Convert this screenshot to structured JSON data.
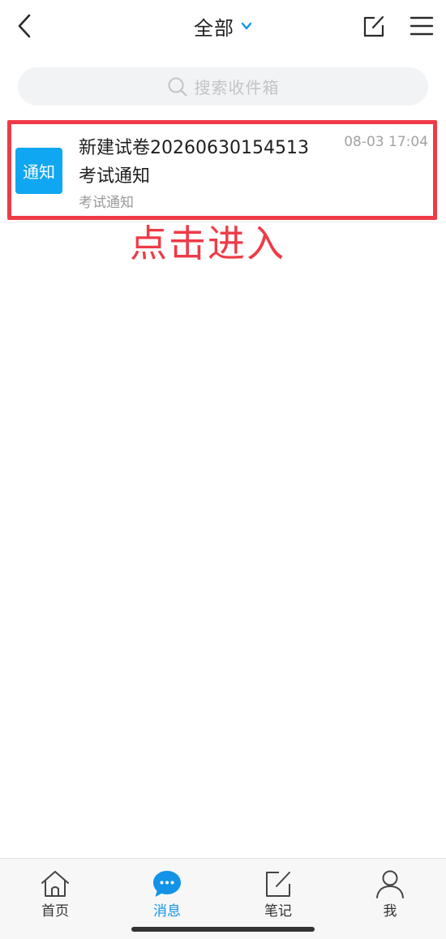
{
  "header": {
    "title": "全部",
    "back_icon": "chevron-left-icon",
    "title_dropdown_icon": "chevron-down-icon",
    "compose_icon": "compose-icon",
    "menu_icon": "hamburger-menu-icon"
  },
  "search": {
    "placeholder": "搜索收件箱",
    "icon": "search-icon"
  },
  "messages": [
    {
      "avatar_text": "通知",
      "avatar_color": "#10a7f2",
      "title_line1": "新建试卷20260630154513",
      "title_line2": "考试通知",
      "preview": "考试通知",
      "time": "08-03 17:04"
    }
  ],
  "annotation": {
    "text": "点击进入",
    "color": "#ee3b47"
  },
  "tabbar": {
    "active_color": "#1293e8",
    "tabs": [
      {
        "label": "首页",
        "icon": "home-icon",
        "active": false
      },
      {
        "label": "消息",
        "icon": "chat-bubble-icon",
        "active": true
      },
      {
        "label": "笔记",
        "icon": "note-edit-icon",
        "active": false
      },
      {
        "label": "我",
        "icon": "user-icon",
        "active": false
      }
    ]
  }
}
